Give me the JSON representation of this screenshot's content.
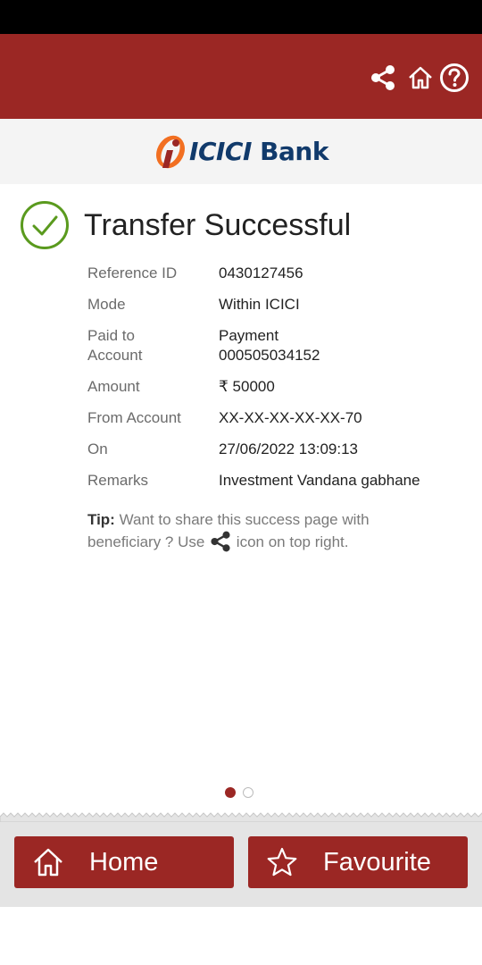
{
  "brand": {
    "logo_text": "ICICI",
    "logo_word": "Bank"
  },
  "header": {
    "icons": [
      "share-icon",
      "home-icon",
      "help-icon"
    ]
  },
  "success": {
    "title": "Transfer Successful"
  },
  "details": [
    {
      "label": "Reference ID",
      "value": "0430127456"
    },
    {
      "label": "Mode",
      "value": "Within ICICI"
    },
    {
      "label": "Paid to\nAccount",
      "value": "Payment\n000505034152"
    },
    {
      "label": "Amount",
      "value": "₹ 50000"
    },
    {
      "label": "From Account",
      "value": "XX-XX-XX-XX-XX-70"
    },
    {
      "label": "On",
      "value": "27/06/2022 13:09:13"
    },
    {
      "label": "Remarks",
      "value": "Investment Vandana gabhane"
    }
  ],
  "tip": {
    "prefix": "Tip:",
    "text_before": " Want to share this success page with beneficiary ? Use ",
    "text_after": " icon on top right."
  },
  "pager": {
    "total": 2,
    "active": 1
  },
  "footer": {
    "home_label": "Home",
    "favourite_label": "Favourite"
  },
  "colors": {
    "primary": "#9b2724",
    "success_green": "#5a9a1e",
    "logo_blue": "#113a6b",
    "logo_orange": "#f26f21"
  }
}
